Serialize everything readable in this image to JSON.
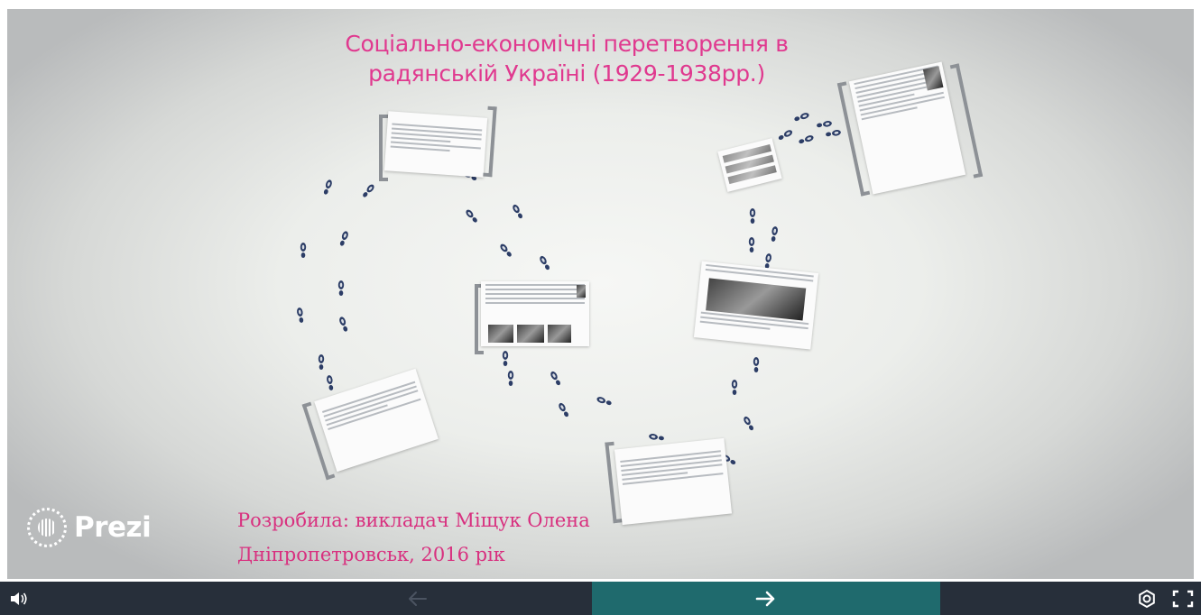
{
  "title_line1": "Соціально-економічні перетворення в",
  "title_line2": "радянській Україні (1929-1938рр.)",
  "author_line1": "Розробила: викладач Міщук Олена",
  "author_line2": "Дніпропетровськ, 2016 рік",
  "logo_text": "Prezi",
  "icons": {
    "volume": "volume-icon",
    "prev": "arrow-left-icon",
    "next": "arrow-right-icon",
    "settings": "gear-icon",
    "fullscreen": "fullscreen-icon",
    "prezi": "prezi-logo-icon"
  },
  "colors": {
    "title": "#e0398f",
    "author": "#d8307f",
    "bar": "#272f3a",
    "next_zone": "#1f6a6d"
  }
}
